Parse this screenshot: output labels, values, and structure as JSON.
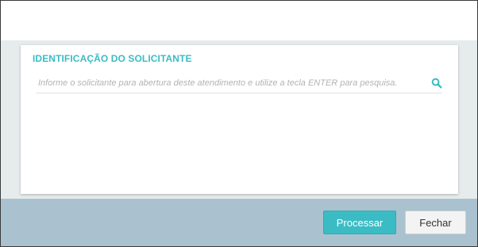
{
  "identification": {
    "title": "IDENTIFICAÇÃO DO SOLICITANTE",
    "search_placeholder": "Informe o solicitante para abertura deste atendimento e utilize a tecla ENTER para pesquisa.",
    "search_value": ""
  },
  "footer": {
    "process_label": "Processar",
    "close_label": "Fechar"
  },
  "icons": {
    "search": "search-icon"
  },
  "colors": {
    "accent": "#3bbcc4",
    "footer_bg": "#aac2cf",
    "body_bg": "#e6ebec"
  }
}
